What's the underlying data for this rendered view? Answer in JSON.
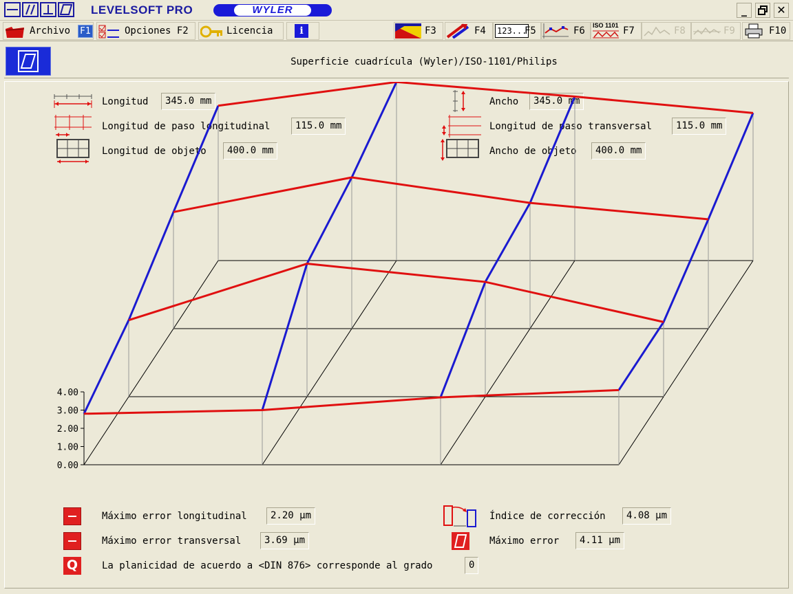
{
  "window": {
    "app_title": "LEVELSOFT PRO",
    "brand": "WYLER",
    "controls": {
      "minimize": "_",
      "restore": "🗗",
      "close": "✕"
    }
  },
  "toolbar": {
    "archivo": {
      "label": "Archivo",
      "key": "F1"
    },
    "opciones": {
      "label": "Opciones F2"
    },
    "licencia": {
      "label": "Licencia"
    },
    "info": {
      "label": "i"
    },
    "f3": "F3",
    "f4": "F4",
    "f5": {
      "icon_text": "123...",
      "label": "F5"
    },
    "f6": "F6",
    "f7": {
      "icon_text": "ISO 1101",
      "label": "F7"
    },
    "f8": "F8",
    "f9": "F9",
    "f10": "F10"
  },
  "header": {
    "title": "Superficie cuadrícula (Wyler)/ISO-1101/Philips"
  },
  "params": {
    "longitud": {
      "label": "Longitud",
      "value": "345.0 mm"
    },
    "paso_longitudinal": {
      "label": "Longitud de paso longitudinal",
      "value": "115.0 mm"
    },
    "longitud_objeto": {
      "label": "Longitud de objeto",
      "value": "400.0 mm"
    },
    "ancho": {
      "label": "Ancho",
      "value": "345.0 mm"
    },
    "paso_transversal": {
      "label": "Longitud de paso transversal",
      "value": "115.0 mm"
    },
    "ancho_objeto": {
      "label": "Ancho de objeto",
      "value": "400.0 mm"
    }
  },
  "results": {
    "max_long": {
      "label": "Máximo error longitudinal",
      "value": "2.20 µm"
    },
    "max_trans": {
      "label": "Máximo error transversal",
      "value": "3.69 µm"
    },
    "planicidad": {
      "label": "La planicidad de acuerdo a <DIN 876> corresponde al grado",
      "value": "0"
    },
    "indice": {
      "label": "Índice de corrección",
      "value": "4.08 µm"
    },
    "max_error": {
      "label": "Máximo error",
      "value": "4.11 µm"
    },
    "q_badge": "Q"
  },
  "colors": {
    "longitudinal": "#e01010",
    "transversal": "#1a1ad0",
    "frame": "#000000",
    "accent": "#1a2bd8"
  },
  "chart_data": {
    "type": "surface-grid",
    "z_ticks": [
      "0.00",
      "1.00",
      "2.00",
      "3.00",
      "4.00"
    ],
    "z_range": [
      0,
      4
    ],
    "unit": "µm",
    "columns": 4,
    "rows": 4,
    "heights": [
      [
        2.8,
        3.0,
        3.7,
        4.1
      ],
      [
        4.2,
        7.3,
        6.3,
        4.1
      ],
      [
        6.4,
        8.3,
        6.9,
        6.0
      ],
      [
        8.5,
        9.8,
        9.0,
        8.1
      ]
    ]
  }
}
